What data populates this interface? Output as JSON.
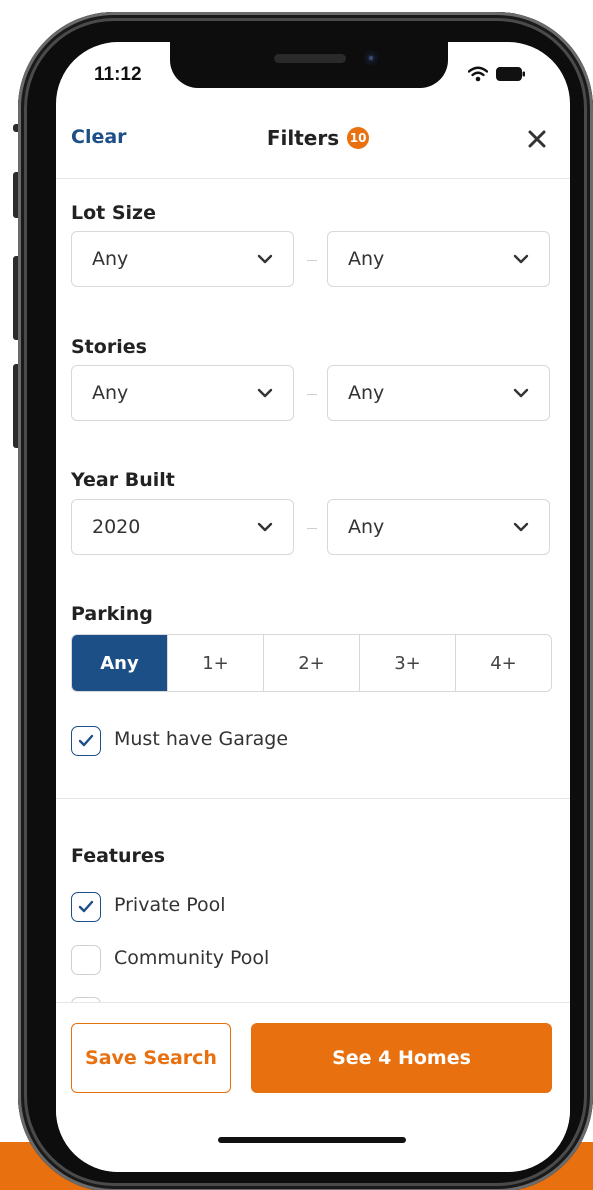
{
  "status_bar": {
    "time": "11:12"
  },
  "header": {
    "clear_label": "Clear",
    "title": "Filters",
    "filter_count": "10"
  },
  "lot_size": {
    "label": "Lot Size",
    "min": "Any",
    "max": "Any"
  },
  "stories": {
    "label": "Stories",
    "min": "Any",
    "max": "Any"
  },
  "year_built": {
    "label": "Year Built",
    "min": "2020",
    "max": "Any"
  },
  "parking": {
    "label": "Parking",
    "options": [
      "Any",
      "1+",
      "2+",
      "3+",
      "4+"
    ],
    "selected": "Any",
    "garage_label": "Must have Garage",
    "garage_checked": true
  },
  "features": {
    "label": "Features",
    "items": [
      {
        "label": "Private Pool",
        "checked": true
      },
      {
        "label": "Community Pool",
        "checked": false
      }
    ]
  },
  "footer": {
    "save_label": "Save Search",
    "see_label": "See 4 Homes"
  },
  "colors": {
    "brand_orange": "#e8700e",
    "navy": "#1c4f86"
  }
}
